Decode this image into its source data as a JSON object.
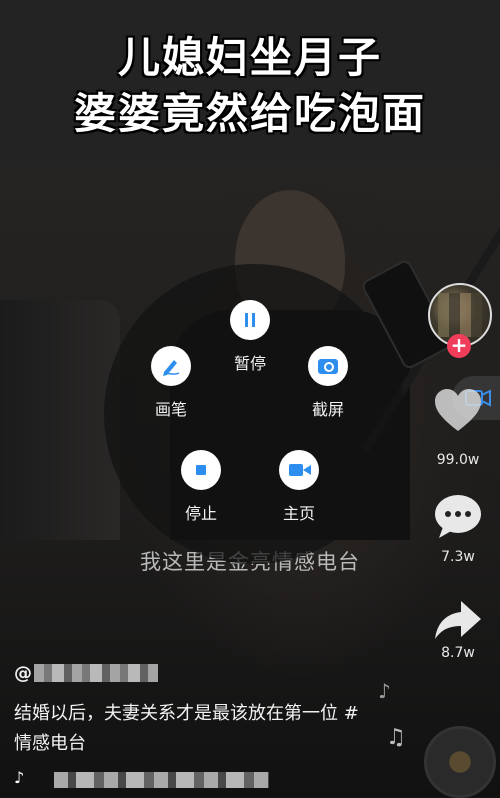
{
  "video": {
    "title_line1": "儿媳妇坐月子",
    "title_line2": "婆婆竟然给吃泡面",
    "subtitle": "我这里是金亮情感电台"
  },
  "radial_menu": {
    "pause": {
      "label": "暂停",
      "icon": "pause-icon"
    },
    "pen": {
      "label": "画笔",
      "icon": "pen-icon"
    },
    "screenshot": {
      "label": "截屏",
      "icon": "camera-icon"
    },
    "stop": {
      "label": "停止",
      "icon": "stop-icon"
    },
    "home": {
      "label": "主页",
      "icon": "video-camera-icon"
    },
    "accent_color": "#2e8ef0"
  },
  "actions": {
    "likes": "99.0w",
    "comments": "7.3w",
    "shares": "8.7w",
    "follow_label": "+"
  },
  "post": {
    "author_prefix": "@",
    "description": "结婚以后，夫妻关系才是最该放在第一位 #情感电台"
  },
  "music": {
    "logo_glyph": "♪"
  }
}
